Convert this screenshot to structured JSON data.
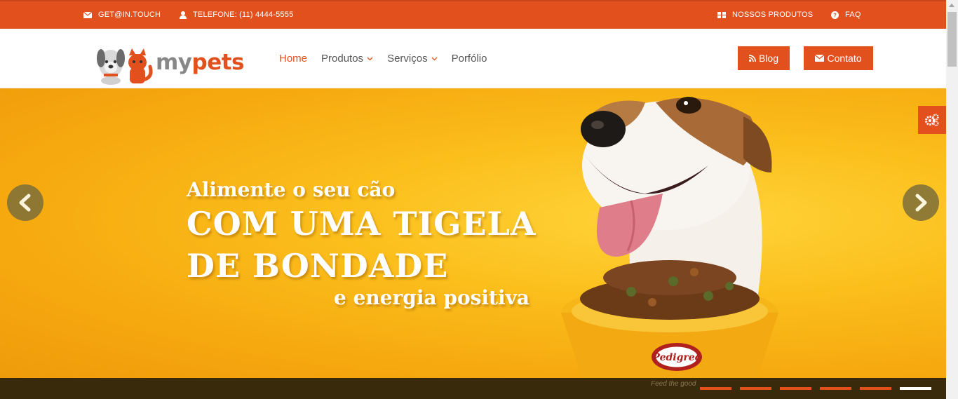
{
  "topbar": {
    "email": "GET@IN.TOUCH",
    "phone": "TELEFONE: (11) 4444-5555",
    "products": "NOSSOS PRODUTOS",
    "faq": "FAQ"
  },
  "logo": {
    "part1": "my",
    "part2": "pets"
  },
  "nav": {
    "items": [
      {
        "label": "Home",
        "active": true,
        "has_dropdown": false
      },
      {
        "label": "Produtos",
        "active": false,
        "has_dropdown": true
      },
      {
        "label": "Serviços",
        "active": false,
        "has_dropdown": true
      },
      {
        "label": "Porfólio",
        "active": false,
        "has_dropdown": false
      }
    ]
  },
  "buttons": {
    "blog": "Blog",
    "contato": "Contato"
  },
  "hero": {
    "line1": "Alimente o seu cão",
    "line2": "COM UMA TIGELA",
    "line3": "DE BONDADE",
    "line4": "e energia positiva",
    "bowl_brand": "Pedigree",
    "tagline": "Feed the good"
  },
  "slider": {
    "indicator_count": 6,
    "active_index": 5
  },
  "colors": {
    "brand": "#e2511d",
    "hero": "#fbbf1c",
    "strip": "#3a2a0c"
  },
  "icons": [
    "envelope-icon",
    "user-icon",
    "grid-icon",
    "question-icon",
    "chevron-down-icon",
    "rss-icon",
    "gears-icon",
    "chevron-left-icon",
    "chevron-right-icon"
  ]
}
